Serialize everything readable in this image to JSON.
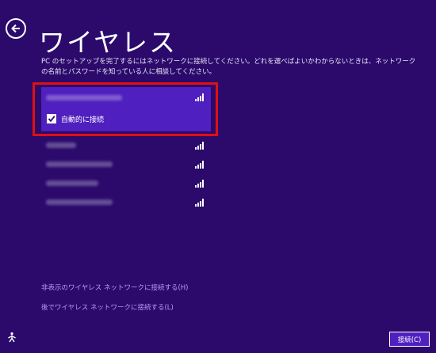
{
  "header": {
    "title": "ワイヤレス"
  },
  "instructions": "PC のセットアップを完了するにはネットワークに接続してください。どれを選べばよいかわからないときは、ネットワークの名前とパスワードを知っている人に相談してください。",
  "networks": [
    {
      "selected": true,
      "signal_bars": 4
    },
    {
      "selected": false,
      "signal_bars": 4
    },
    {
      "selected": false,
      "signal_bars": 4
    },
    {
      "selected": false,
      "signal_bars": 4
    },
    {
      "selected": false,
      "signal_bars": 4
    }
  ],
  "auto_connect": {
    "label": "自動的に接続",
    "checked": true
  },
  "links": {
    "hidden_network": "非表示のワイヤレス ネットワークに接続する(H)",
    "connect_later": "後でワイヤレス ネットワークに接続する(L)"
  },
  "buttons": {
    "connect": "接続(C)"
  },
  "icons": {
    "back": "back-arrow-icon",
    "ease_of_access": "ease-of-access-icon",
    "signal": "wifi-signal-icon"
  },
  "colors": {
    "background": "#2b0a6c",
    "selected": "#4f1fbf",
    "highlight": "#e01010",
    "link": "#b89af3"
  }
}
